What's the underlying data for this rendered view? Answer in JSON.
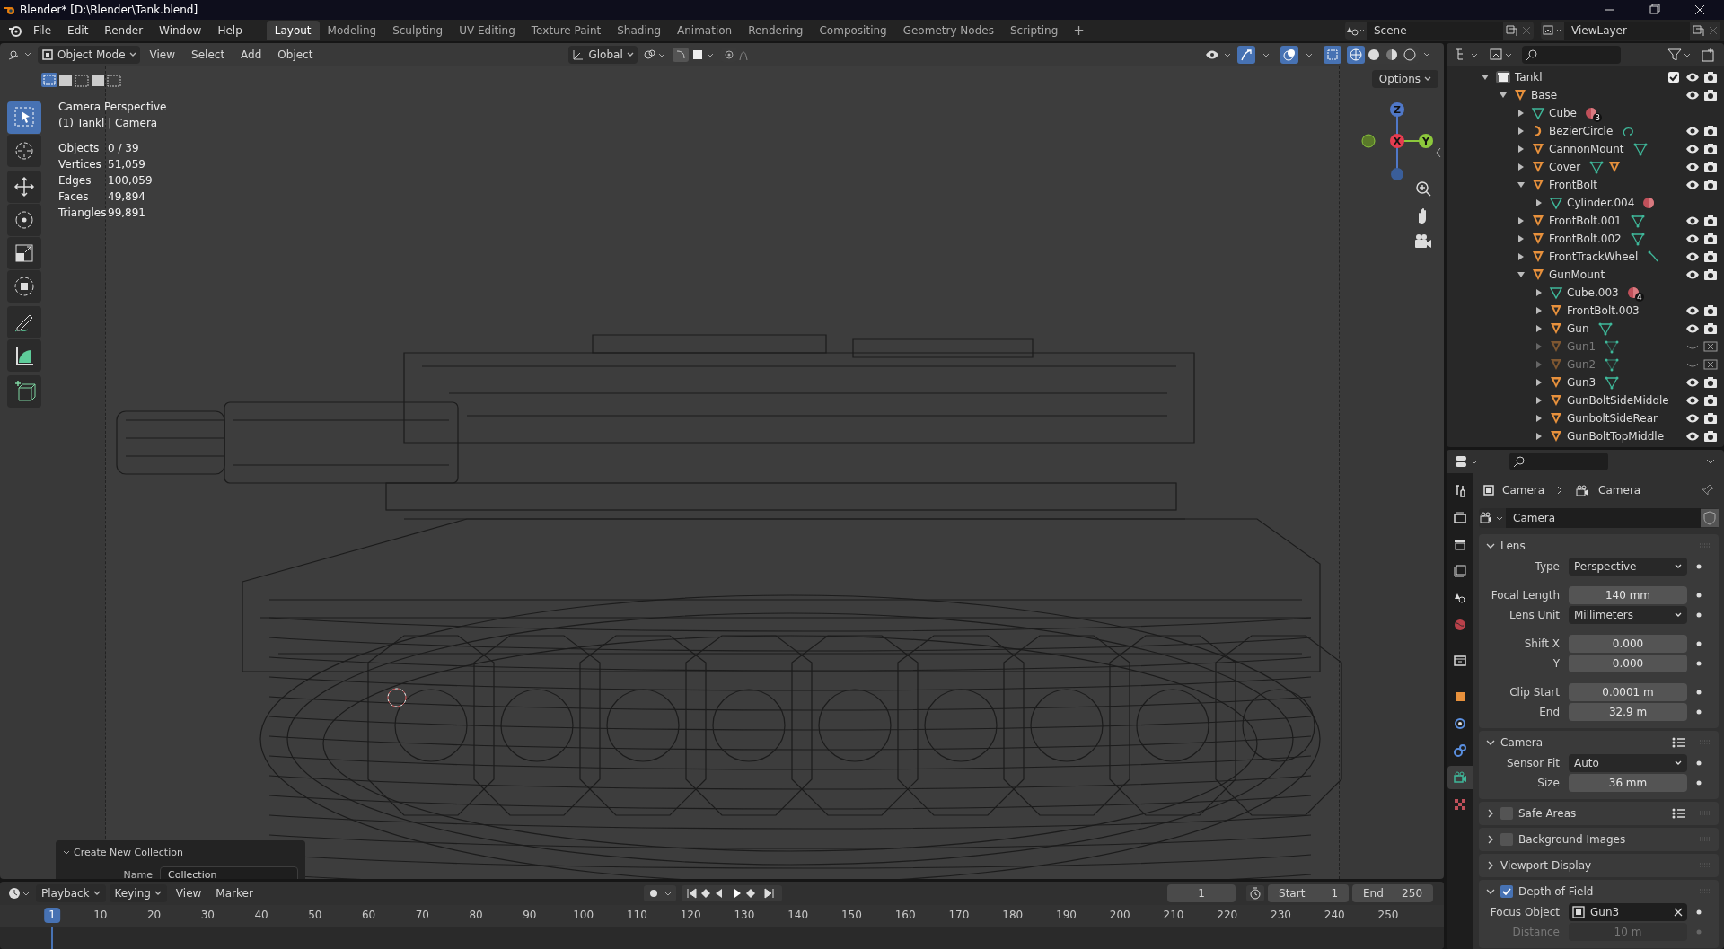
{
  "window": {
    "title": "Blender* [D:\\Blender\\Tank.blend]"
  },
  "menus": [
    "File",
    "Edit",
    "Render",
    "Window",
    "Help"
  ],
  "workspaces": [
    {
      "label": "Layout",
      "selected": true
    },
    {
      "label": "Modeling",
      "selected": false
    },
    {
      "label": "Sculpting",
      "selected": false
    },
    {
      "label": "UV Editing",
      "selected": false
    },
    {
      "label": "Texture Paint",
      "selected": false
    },
    {
      "label": "Shading",
      "selected": false
    },
    {
      "label": "Animation",
      "selected": false
    },
    {
      "label": "Rendering",
      "selected": false
    },
    {
      "label": "Compositing",
      "selected": false
    },
    {
      "label": "Geometry Nodes",
      "selected": false
    },
    {
      "label": "Scripting",
      "selected": false
    }
  ],
  "add_workspace": "+",
  "scene": "Scene",
  "view_layer": "ViewLayer",
  "viewport": {
    "mode": "Object Mode",
    "menus": [
      "View",
      "Select",
      "Add",
      "Object"
    ],
    "orientation": "Global",
    "options": "Options",
    "tools": [
      {
        "kind": "select",
        "selected": true
      },
      {
        "kind": "cursor",
        "selected": false
      },
      {
        "kind": "move",
        "selected": false
      },
      {
        "kind": "rotate",
        "selected": false
      },
      {
        "kind": "scale",
        "selected": false
      },
      {
        "kind": "transform",
        "selected": false
      },
      {
        "kind": "annotate",
        "selected": false
      },
      {
        "kind": "measure",
        "selected": false
      },
      {
        "kind": "add-cube",
        "selected": false
      }
    ],
    "view_name": "Camera Perspective",
    "object_info": "(1) Tankl | Camera",
    "stats": [
      {
        "label": "Objects",
        "value": "0 / 39"
      },
      {
        "label": "Vertices",
        "value": "51,059"
      },
      {
        "label": "Edges",
        "value": "100,059"
      },
      {
        "label": "Faces",
        "value": "49,894"
      },
      {
        "label": "Triangles",
        "value": "99,891"
      }
    ],
    "gizmo": {
      "x": "X",
      "y": "Y",
      "z": "Z"
    },
    "redo_panel": {
      "title": "Create New Collection",
      "label": "Name",
      "value": "Collection"
    }
  },
  "outliner": [
    {
      "name": "Tankl",
      "kind": "collection",
      "expanded": true,
      "toggles": true,
      "hidden": false,
      "children": [
        {
          "name": "Base",
          "kind": "object",
          "expanded": true,
          "toggles": true,
          "hidden": false,
          "children": [
            {
              "name": "Cube",
              "kind": "mesh",
              "expanded": false,
              "toggles": false,
              "hidden": false,
              "badges": [
                {
                  "kind": "material",
                  "count": "3"
                }
              ]
            },
            {
              "name": "BezierCircle",
              "kind": "curve",
              "expanded": false,
              "toggles": true,
              "hidden": false,
              "badges": [
                {
                  "kind": "curve"
                }
              ]
            },
            {
              "name": "CannonMount",
              "kind": "object",
              "expanded": false,
              "toggles": true,
              "hidden": false,
              "badges": [
                {
                  "kind": "mesh"
                }
              ]
            },
            {
              "name": "Cover",
              "kind": "object",
              "expanded": false,
              "toggles": true,
              "hidden": false,
              "badges": [
                {
                  "kind": "mesh"
                },
                {
                  "kind": "object"
                }
              ]
            },
            {
              "name": "FrontBolt",
              "kind": "object",
              "expanded": true,
              "toggles": true,
              "hidden": false,
              "children": [
                {
                  "name": "Cylinder.004",
                  "kind": "mesh",
                  "expanded": false,
                  "toggles": false,
                  "hidden": false,
                  "badges": [
                    {
                      "kind": "material"
                    }
                  ]
                }
              ]
            },
            {
              "name": "FrontBolt.001",
              "kind": "object",
              "expanded": false,
              "toggles": true,
              "hidden": false,
              "badges": [
                {
                  "kind": "mesh"
                }
              ]
            },
            {
              "name": "FrontBolt.002",
              "kind": "object",
              "expanded": false,
              "toggles": true,
              "hidden": false,
              "badges": [
                {
                  "kind": "mesh"
                }
              ]
            },
            {
              "name": "FrontTrackWheel",
              "kind": "object",
              "expanded": false,
              "toggles": true,
              "hidden": false,
              "badges": [
                {
                  "kind": "bone"
                }
              ]
            },
            {
              "name": "GunMount",
              "kind": "object",
              "expanded": true,
              "toggles": true,
              "hidden": false,
              "children": [
                {
                  "name": "Cube.003",
                  "kind": "mesh",
                  "expanded": false,
                  "toggles": false,
                  "hidden": false,
                  "badges": [
                    {
                      "kind": "material",
                      "count": "4"
                    }
                  ]
                },
                {
                  "name": "FrontBolt.003",
                  "kind": "object",
                  "expanded": false,
                  "toggles": true,
                  "hidden": false
                },
                {
                  "name": "Gun",
                  "kind": "object",
                  "expanded": false,
                  "toggles": true,
                  "hidden": false,
                  "badges": [
                    {
                      "kind": "mesh"
                    }
                  ]
                },
                {
                  "name": "Gun1",
                  "kind": "object",
                  "expanded": false,
                  "toggles": true,
                  "hidden": true,
                  "badges": [
                    {
                      "kind": "mesh"
                    }
                  ]
                },
                {
                  "name": "Gun2",
                  "kind": "object",
                  "expanded": false,
                  "toggles": true,
                  "hidden": true,
                  "badges": [
                    {
                      "kind": "mesh"
                    }
                  ]
                },
                {
                  "name": "Gun3",
                  "kind": "object",
                  "expanded": false,
                  "toggles": true,
                  "hidden": false,
                  "badges": [
                    {
                      "kind": "mesh"
                    }
                  ]
                },
                {
                  "name": "GunBoltSideMiddle",
                  "kind": "object",
                  "expanded": false,
                  "toggles": true,
                  "hidden": false
                },
                {
                  "name": "GunboltSideRear",
                  "kind": "object",
                  "expanded": false,
                  "toggles": true,
                  "hidden": false
                },
                {
                  "name": "GunBoltTopMiddle",
                  "kind": "object",
                  "expanded": false,
                  "toggles": true,
                  "hidden": false
                }
              ]
            }
          ]
        }
      ]
    }
  ],
  "properties": {
    "tabs": [
      {
        "kind": "tool",
        "selected": false
      },
      {
        "kind": "render",
        "selected": false
      },
      {
        "kind": "output",
        "selected": false
      },
      {
        "kind": "view-layer",
        "selected": false
      },
      {
        "kind": "scene",
        "selected": false
      },
      {
        "kind": "world",
        "selected": false
      },
      {
        "kind": "collection",
        "selected": false
      },
      {
        "kind": "object",
        "selected": false
      },
      {
        "kind": "physics",
        "selected": false
      },
      {
        "kind": "constraints",
        "selected": false
      },
      {
        "kind": "camera-data",
        "selected": true
      },
      {
        "kind": "texture",
        "selected": false
      }
    ],
    "breadcrumb": [
      "Camera",
      "Camera"
    ],
    "datablock": "Camera",
    "panels": [
      {
        "title": "Lens",
        "expanded": true,
        "list_icon": false,
        "rows": [
          {
            "label": "Type",
            "value": "Perspective",
            "kind": "dropdown",
            "gap": false,
            "disabled": false
          },
          {
            "label": "Focal Length",
            "value": "140 mm",
            "kind": "number",
            "gap": true,
            "disabled": false
          },
          {
            "label": "Lens Unit",
            "value": "Millimeters",
            "kind": "dropdown",
            "gap": false,
            "disabled": false
          },
          {
            "label": "Shift X",
            "value": "0.000",
            "kind": "number",
            "gap": true,
            "disabled": false
          },
          {
            "label": "Y",
            "value": "0.000",
            "kind": "number",
            "gap": false,
            "disabled": false
          },
          {
            "label": "Clip Start",
            "value": "0.0001 m",
            "kind": "number",
            "gap": true,
            "disabled": false
          },
          {
            "label": "End",
            "value": "32.9 m",
            "kind": "number",
            "gap": false,
            "disabled": false
          }
        ]
      },
      {
        "title": "Camera",
        "expanded": true,
        "list_icon": true,
        "rows": [
          {
            "label": "Sensor Fit",
            "value": "Auto",
            "kind": "dropdown",
            "gap": false,
            "disabled": false
          },
          {
            "label": "Size",
            "value": "36 mm",
            "kind": "number",
            "gap": false,
            "disabled": false
          }
        ]
      },
      {
        "title": "Safe Areas",
        "expanded": false,
        "checked": false,
        "list_icon": true
      },
      {
        "title": "Background Images",
        "expanded": false,
        "checked": false,
        "list_icon": false
      },
      {
        "title": "Viewport Display",
        "expanded": false,
        "list_icon": false
      },
      {
        "title": "Depth of Field",
        "expanded": true,
        "checked": true,
        "list_icon": false,
        "rows": [
          {
            "label": "Focus Object",
            "value": "Gun3",
            "kind": "object",
            "gap": false,
            "disabled": false
          },
          {
            "label": "Distance",
            "value": "10 m",
            "kind": "number",
            "gap": false,
            "disabled": true
          }
        ]
      }
    ]
  },
  "timeline": {
    "menus": [
      "Playback",
      "Keying",
      "View",
      "Marker"
    ],
    "current_frame": "1",
    "start_label": "Start",
    "start": "1",
    "end_label": "End",
    "end": "250",
    "ticks": [
      "1",
      "10",
      "20",
      "30",
      "40",
      "50",
      "60",
      "70",
      "80",
      "90",
      "100",
      "110",
      "120",
      "130",
      "140",
      "150",
      "160",
      "170",
      "180",
      "190",
      "200",
      "210",
      "220",
      "230",
      "240",
      "250"
    ]
  }
}
